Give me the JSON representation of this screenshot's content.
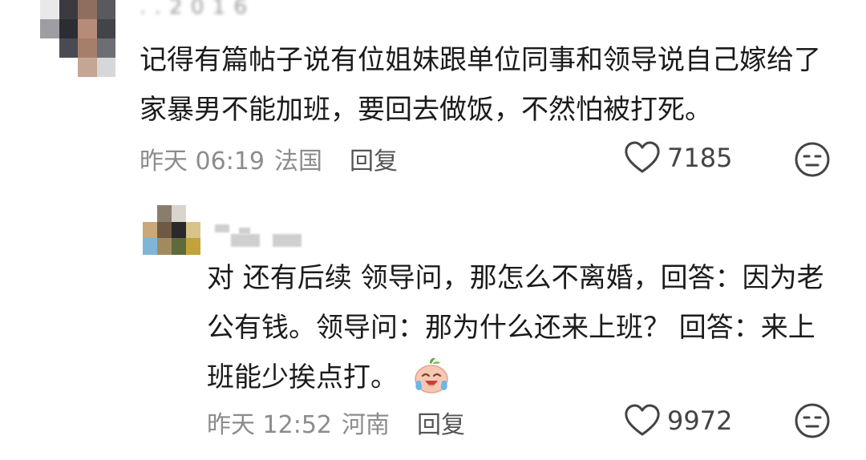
{
  "comments": {
    "main": {
      "text": "记得有篇帖子说有位姐妹跟单位同事和领导说自己嫁给了家暴男不能加班，要回去做饭，不然怕被打死。",
      "time": "昨天 06:19",
      "location": "法国",
      "reply_label": "回复",
      "likes": "7185"
    },
    "reply": {
      "text": "对 还有后续 领导问，那怎么不离婚，回答：因为老公有钱。领导问：那为什么还来上班？ 回答：来上班能少挨点打。",
      "emoji_icon": "crying-laughing-face-icon",
      "time": "昨天 12:52",
      "location": "河南",
      "reply_label": "回复",
      "likes": "9972"
    }
  },
  "colors": {
    "text": "#1b1b1b",
    "meta": "#8c8c8c",
    "reply_button": "#555555",
    "icon_stroke": "#444444",
    "background": "#ffffff"
  }
}
